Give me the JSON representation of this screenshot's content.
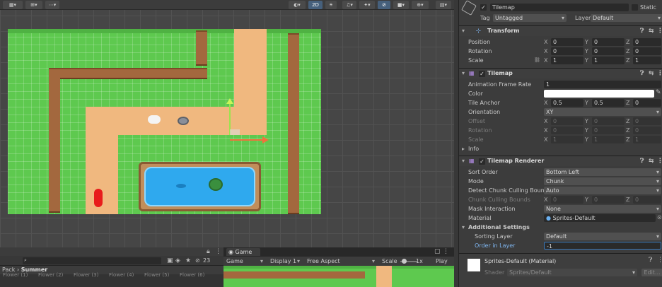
{
  "scene": {
    "toolbar": {
      "mode_2d": "2D",
      "btn_icons": [
        "grid-icon",
        "snap-icon",
        "view-icon",
        "light-icon",
        "audio-icon",
        "effects-icon",
        "hidden-icon",
        "camera-icon",
        "gizmo-icon",
        "layers-icon"
      ]
    }
  },
  "project": {
    "path_prefix": "Pack",
    "path_sep": "›",
    "path_current": "Summer",
    "hidden_count": "23",
    "files": [
      "Flower (1)",
      "Flower (2)",
      "Flower (3)",
      "Flower (4)",
      "Flower (5)",
      "Flower (6)"
    ]
  },
  "game": {
    "tab": "Game",
    "display_mode": "Game",
    "display": "Display 1",
    "aspect": "Free Aspect",
    "scale_label": "Scale",
    "scale_value": "1x",
    "play_focus": "Play Foc"
  },
  "inspector": {
    "name": "Tilemap",
    "static_label": "Static",
    "tag_label": "Tag",
    "tag_value": "Untagged",
    "layer_label": "Layer",
    "layer_value": "Default",
    "transform": {
      "title": "Transform",
      "position_label": "Position",
      "rotation_label": "Rotation",
      "scale_label": "Scale",
      "position": [
        "0",
        "0",
        "0"
      ],
      "rotation": [
        "0",
        "0",
        "0"
      ],
      "scale": [
        "1",
        "1",
        "1"
      ]
    },
    "tilemap": {
      "title": "Tilemap",
      "anim_rate_label": "Animation Frame Rate",
      "anim_rate": "1",
      "color_label": "Color",
      "tile_anchor_label": "Tile Anchor",
      "tile_anchor": [
        "0.5",
        "0.5",
        "0"
      ],
      "orientation_label": "Orientation",
      "orientation": "XY",
      "offset_label": "Offset",
      "offset": [
        "0",
        "0",
        "0"
      ],
      "rotation_label": "Rotation",
      "rotation": [
        "0",
        "0",
        "0"
      ],
      "scale_label": "Scale",
      "scale": [
        "1",
        "1",
        "1"
      ],
      "info_label": "Info"
    },
    "renderer": {
      "title": "Tilemap Renderer",
      "sort_order_label": "Sort Order",
      "sort_order": "Bottom Left",
      "mode_label": "Mode",
      "mode": "Chunk",
      "culling_label": "Detect Chunk Culling Bounds",
      "culling": "Auto",
      "chunk_bounds_label": "Chunk Culling Bounds",
      "chunk_bounds": [
        "0",
        "0",
        "0"
      ],
      "mask_label": "Mask Interaction",
      "mask": "None",
      "material_label": "Material",
      "material": "Sprites-Default",
      "additional_label": "Additional Settings",
      "sorting_layer_label": "Sorting Layer",
      "sorting_layer": "Default",
      "order_label": "Order in Layer",
      "order": "-1"
    },
    "material": {
      "title": "Sprites-Default (Material)",
      "shader_label": "Shader",
      "shader": "Sprites/Default",
      "edit": "Edit..."
    },
    "axes": [
      "X",
      "Y",
      "Z"
    ]
  }
}
